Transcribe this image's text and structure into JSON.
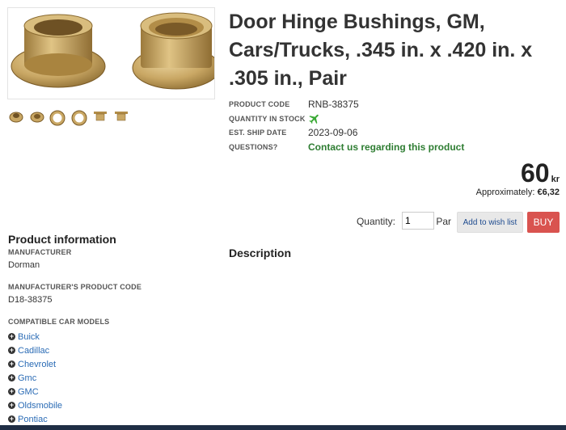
{
  "product": {
    "title": "Door Hinge Bushings, GM, Cars/Trucks, .345 in. x .420 in. x .305 in., Pair"
  },
  "specs": {
    "product_code_label": "PRODUCT CODE",
    "product_code": "RNB-38375",
    "quantity_label": "QUANTITY IN STOCK",
    "stock_icon": "airplane-icon",
    "ship_label": "EST. SHIP DATE",
    "ship_date": "2023-09-06",
    "questions_label": "QUESTIONS?",
    "questions_link": "Contact us regarding this product"
  },
  "price": {
    "amount": "60",
    "currency": "kr",
    "approx_label": "Approximately:",
    "approx_value": "€6,32"
  },
  "purchase": {
    "quantity_label": "Quantity:",
    "quantity_value": "1",
    "unit": "Par",
    "wishlist_label": "Add to wish list",
    "buy_label": "BUY"
  },
  "product_info": {
    "heading": "Product information",
    "manufacturer_label": "MANUFACTURER",
    "manufacturer": "Dorman",
    "mpc_label": "MANUFACTURER'S PRODUCT CODE",
    "mpc": "D18-38375",
    "models_label": "COMPATIBLE CAR MODELS",
    "models": [
      "Buick",
      "Cadillac",
      "Chevrolet",
      "Gmc",
      "GMC",
      "Oldsmobile",
      "Pontiac"
    ]
  },
  "description": {
    "heading": "Description"
  },
  "colors": {
    "link_green": "#2e7d32",
    "link_blue": "#2a6bb5",
    "buy_red": "#d9534f",
    "bronze": "#c9a764"
  }
}
